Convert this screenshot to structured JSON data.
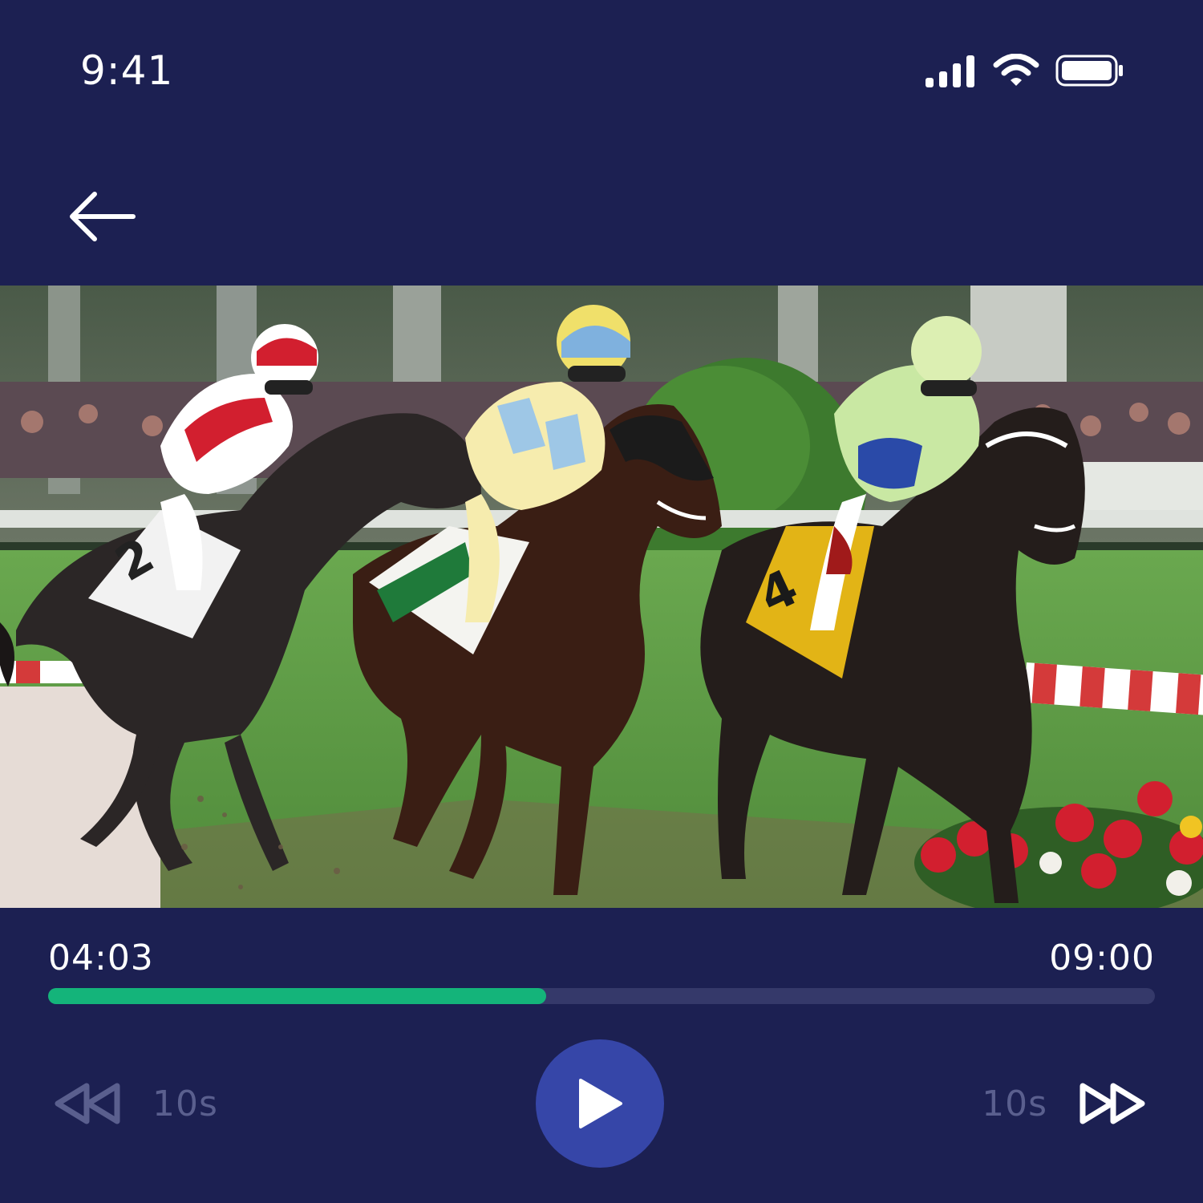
{
  "status_bar": {
    "time": "9:41",
    "icons": [
      "cellular-signal-icon",
      "wifi-icon",
      "battery-icon"
    ]
  },
  "nav": {
    "back_icon": "arrow-left-icon"
  },
  "video": {
    "description_icon": "video-frame"
  },
  "player": {
    "current_time": "04:03",
    "total_time": "09:00",
    "progress": 0.45,
    "rewind_label": "10s",
    "forward_label": "10s",
    "rewind_icon": "rewind-icon",
    "forward_icon": "fast-forward-icon",
    "play_icon": "play-icon"
  },
  "colors": {
    "background": "#1c2052",
    "accent_progress": "#14b47a",
    "play_button": "#3646a8",
    "inactive": "#5a5f8e",
    "track": "#35396a"
  }
}
